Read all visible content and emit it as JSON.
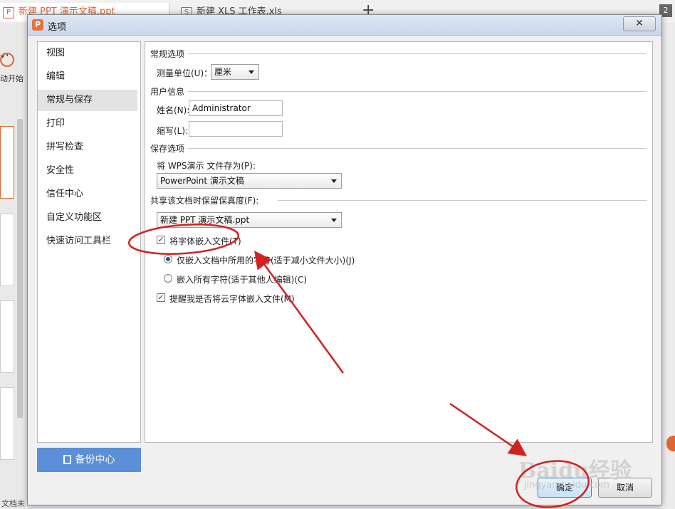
{
  "background": {
    "tabs": [
      {
        "label": "新建 PPT 演示文稿.ppt",
        "icon": "P"
      },
      {
        "label": "新建 XLS 工作表.xls",
        "icon": "S"
      }
    ],
    "tab_count": "2",
    "left_start_label": "动开始",
    "status_text": "文档未"
  },
  "dialog": {
    "title": "选项",
    "close_glyph": "✕",
    "nav": {
      "items": [
        {
          "label": "视图"
        },
        {
          "label": "编辑"
        },
        {
          "label": "常规与保存"
        },
        {
          "label": "打印"
        },
        {
          "label": "拼写检查"
        },
        {
          "label": "安全性"
        },
        {
          "label": "信任中心"
        },
        {
          "label": "自定义功能区"
        },
        {
          "label": "快速访问工具栏"
        }
      ],
      "active_index": 2
    },
    "backup_label": "备份中心",
    "general": {
      "section_title": "常规选项",
      "unit_label": "测量单位(U)：",
      "unit_value": "厘米"
    },
    "user_info": {
      "section_title": "用户信息",
      "name_label": "姓名(N):",
      "name_value": "Administrator",
      "initials_label": "缩写(L):",
      "initials_value": ""
    },
    "save": {
      "section_title": "保存选项",
      "save_as_label": "将 WPS演示 文件存为(P):",
      "save_as_value": "PowerPoint 演示文稿"
    },
    "fidelity": {
      "section_title": "共享该文档时保留保真度(F):",
      "document_value": "新建 PPT 演示文稿.ppt",
      "embed_fonts_label": "将字体嵌入文件(T)",
      "embed_fonts_checked": true,
      "embed_used_label": "仅嵌入文档中所用的字符(适于减小文件大小)(J)",
      "embed_used_selected": true,
      "embed_all_label": "嵌入所有字符(适于其他人编辑)(C)",
      "embed_all_selected": false,
      "remind_cloud_label": "提醒我是否将云字体嵌入文件(M)",
      "remind_cloud_checked": true
    },
    "ok_label": "确定",
    "cancel_label": "取消"
  },
  "annotation_color": "#d42020",
  "watermark": {
    "text": "Baidu经验",
    "sub": "jingyan.baidu.com"
  }
}
